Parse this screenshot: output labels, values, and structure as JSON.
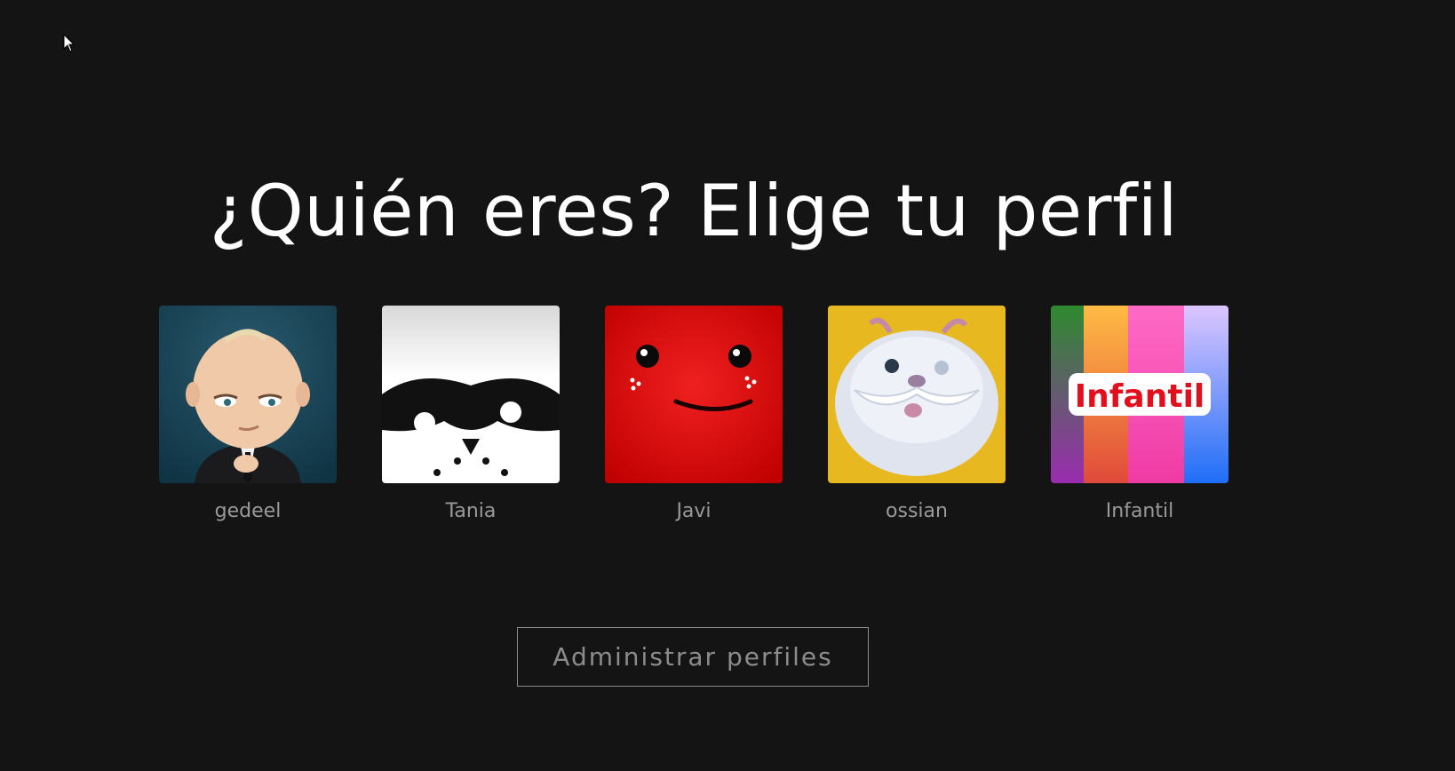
{
  "page": {
    "title": "¿Quién eres? Elige tu perfil"
  },
  "profiles": [
    {
      "name": "gedeel",
      "avatar": "boss-baby-avatar"
    },
    {
      "name": "Tania",
      "avatar": "raccoon-mask-avatar"
    },
    {
      "name": "Javi",
      "avatar": "red-fluffy-monster-avatar"
    },
    {
      "name": "ossian",
      "avatar": "white-furry-creature-avatar"
    },
    {
      "name": "Infantil",
      "avatar": "kids-stripes-avatar",
      "avatar_text": "Infantil"
    }
  ],
  "manage_button": {
    "label": "Administrar perfiles"
  },
  "colors": {
    "background": "#141414",
    "title": "#ffffff",
    "profile_name": "#9a9a9a",
    "button_border": "#8c8c8c"
  }
}
